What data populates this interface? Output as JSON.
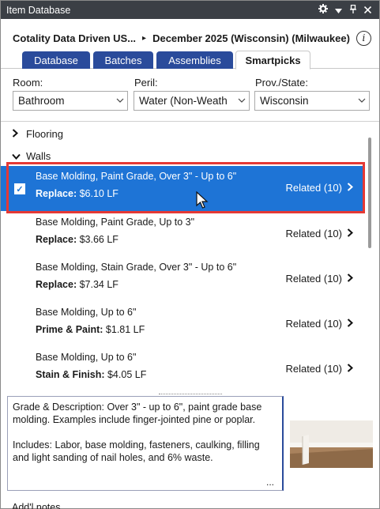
{
  "window": {
    "title": "Item Database"
  },
  "header": {
    "source": "Cotality Data Driven US...",
    "separator": "▸",
    "pricelist": "December 2025 (Wisconsin) (Milwaukee)",
    "info_glyph": "i"
  },
  "tabs": [
    {
      "label": "Database",
      "active": false
    },
    {
      "label": "Batches",
      "active": false
    },
    {
      "label": "Assemblies",
      "active": false
    },
    {
      "label": "Smartpicks",
      "active": true
    }
  ],
  "filters": {
    "room": {
      "label": "Room:",
      "value": "Bathroom"
    },
    "peril": {
      "label": "Peril:",
      "value": "Water (Non-Weath"
    },
    "state": {
      "label": "Prov./State:",
      "value": "Wisconsin"
    }
  },
  "groups": [
    {
      "label": "Flooring",
      "expanded": false
    },
    {
      "label": "Walls",
      "expanded": true
    }
  ],
  "items": [
    {
      "name": "Base Molding, Paint Grade, Over 3\" - Up to 6\"",
      "action": "Replace:",
      "price": "$6.10 LF",
      "related": "Related (10)",
      "selected": true,
      "checked": true
    },
    {
      "name": "Base Molding, Paint Grade, Up to 3\"",
      "action": "Replace:",
      "price": "$3.66 LF",
      "related": "Related (10)",
      "selected": false
    },
    {
      "name": "Base Molding, Stain Grade, Over 3\" - Up to 6\"",
      "action": "Replace:",
      "price": "$7.34 LF",
      "related": "Related (10)",
      "selected": false
    },
    {
      "name": "Base Molding, Up to 6\"",
      "action": "Prime & Paint:",
      "price": "$1.81 LF",
      "related": "Related (10)",
      "selected": false
    },
    {
      "name": "Base Molding, Up to 6\"",
      "action": "Stain & Finish:",
      "price": "$4.05 LF",
      "related": "Related (10)",
      "selected": false
    }
  ],
  "description": {
    "text": "Grade & Description: Over 3\" - up to 6\", paint grade base molding. Examples include finger-jointed pine or poplar.",
    "includes": "Includes: Labor, base molding, fasteners, caulking, filling and light sanding of nail holes, and 6% waste.",
    "more": "..."
  },
  "footer": {
    "partial_text": "Add'l notes"
  },
  "colors": {
    "titlebar": "#3b3f45",
    "tab": "#2a4b9b",
    "selection": "#1e74d6",
    "highlight_border": "#e53935"
  }
}
